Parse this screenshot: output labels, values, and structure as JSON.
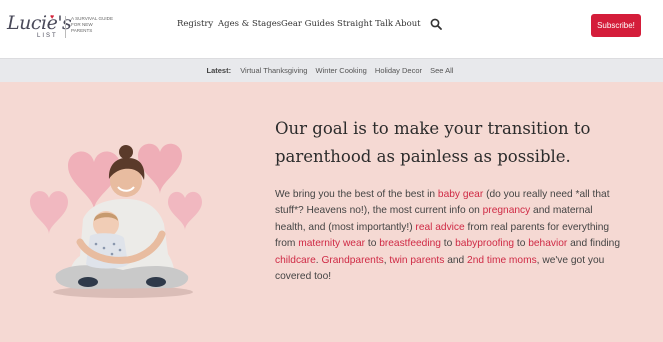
{
  "header": {
    "logo_script": "Lucie's",
    "logo_list": "LIST",
    "logo_tagline": "A survival guide for new parents",
    "nav": [
      "Registry",
      "Ages & Stages",
      "Gear Guides",
      "Straight Talk",
      "About"
    ],
    "subscribe_label": "Subscribe!"
  },
  "latest": {
    "label": "Latest:",
    "links": [
      "Virtual Thanksgiving",
      "Winter Cooking",
      "Holiday Decor",
      "See All"
    ]
  },
  "hero": {
    "headline": "Our goal is to make your transition to parenthood as painless as possible.",
    "body": {
      "t1": "We bring you the best of the best in ",
      "l1": "baby gear",
      "t2": " (do you really need *all that stuff*? Heavens no!), the most current info on ",
      "l2": "pregnancy",
      "t3": " and maternal health, and (most importantly!) ",
      "l3": "real advice",
      "t4": " from real parents for everything from ",
      "l4": "maternity wear",
      "t5": " to ",
      "l5": "breastfeeding",
      "t6": " to ",
      "l6": "babyproofing",
      "t7": " to ",
      "l7": "behavior",
      "t8": " and finding ",
      "l8": "childcare",
      "t9": ". ",
      "l9": "Grandparents",
      "t10": ", ",
      "l10": "twin parents",
      "t11": " and ",
      "l11": "2nd time moms",
      "t12": ", we've got you covered too!"
    }
  },
  "colors": {
    "accent": "#d41d3a",
    "link": "#cf2a45",
    "hero_bg": "#f5d9d3",
    "heart": "#eea8b4"
  }
}
